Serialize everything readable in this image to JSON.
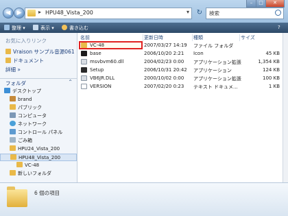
{
  "address": {
    "path": "HPU48_Vista_200"
  },
  "search": {
    "placeholder": "検索"
  },
  "toolbar": {
    "organize": "整理 ▾",
    "views": "表示 ▾",
    "burn": "書き込む"
  },
  "leftpane": {
    "favorites_head": "お気に入りリンク",
    "favorites": [
      "Vraison サンプル音源061...",
      "ドキュメント"
    ],
    "more": "詳細 »",
    "folders_label": "フォルダ",
    "tree": [
      "デスクトップ",
      "brand",
      "パブリック",
      "コンピュータ",
      "ネットワーク",
      "コントロール パネル",
      "ごみ箱",
      "HPU24_Vista_200",
      "HPU48_Vista_200",
      "VC-48",
      "新しいフォルダ"
    ]
  },
  "columns": {
    "name": "名前",
    "date": "更新日時",
    "type": "種類",
    "size": "サイズ"
  },
  "files": [
    {
      "name": "VC-48",
      "date": "2007/03/27 14:19",
      "type": "ファイル フォルダ",
      "size": ""
    },
    {
      "name": "base",
      "date": "2006/10/20 2:21",
      "type": "Icon",
      "size": "45 KB"
    },
    {
      "name": "msvbvm60.dll",
      "date": "2004/02/23 0:00",
      "type": "アプリケーション拡張",
      "size": "1,354 KB"
    },
    {
      "name": "Setup",
      "date": "2006/10/31 20:42",
      "type": "アプリケーション",
      "size": "124 KB"
    },
    {
      "name": "VB6JR.DLL",
      "date": "2000/10/02 0:00",
      "type": "アプリケーション拡張",
      "size": "100 KB"
    },
    {
      "name": "VERSION",
      "date": "2007/02/20 0:23",
      "type": "テキスト ドキュメ...",
      "size": "1 KB"
    }
  ],
  "status": {
    "count": "6 個の項目"
  },
  "colors": {
    "highlight": "#e02020",
    "toolbar": "#3a5878",
    "selected": "#d9e6f5"
  }
}
